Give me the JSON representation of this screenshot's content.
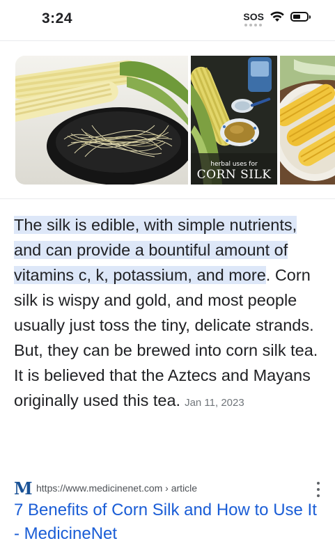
{
  "status_bar": {
    "time": "3:24",
    "sos": "SOS",
    "wifi_icon": "wifi-icon",
    "battery_icon": "battery-icon"
  },
  "carousel": {
    "images": [
      {
        "name": "corn-silk-bowl-image",
        "caption_small": "",
        "caption_big": ""
      },
      {
        "name": "corn-silk-herbal-image",
        "caption_small": "herbal uses for",
        "caption_big": "CORN SILK"
      },
      {
        "name": "corn-cobs-image",
        "caption_small": "",
        "caption_big": ""
      }
    ]
  },
  "snippet": {
    "highlighted": "The silk is edible, with simple nutrients, and can provide a bountiful amount of vitamins c, k, potassium, and more",
    "rest": ". Corn silk is wispy and gold, and most people usually just toss the tiny, delicate strands. But, they can be brewed into corn silk tea. It is believed that the Aztecs and Mayans originally used this tea.",
    "date": "Jan 11, 2023"
  },
  "source": {
    "favicon_letter": "M",
    "url": "https://www.medicinenet.com › article",
    "more_icon": "more-vert-icon"
  },
  "result": {
    "title": "7 Benefits of Corn Silk and How to Use It - MedicineNet"
  }
}
